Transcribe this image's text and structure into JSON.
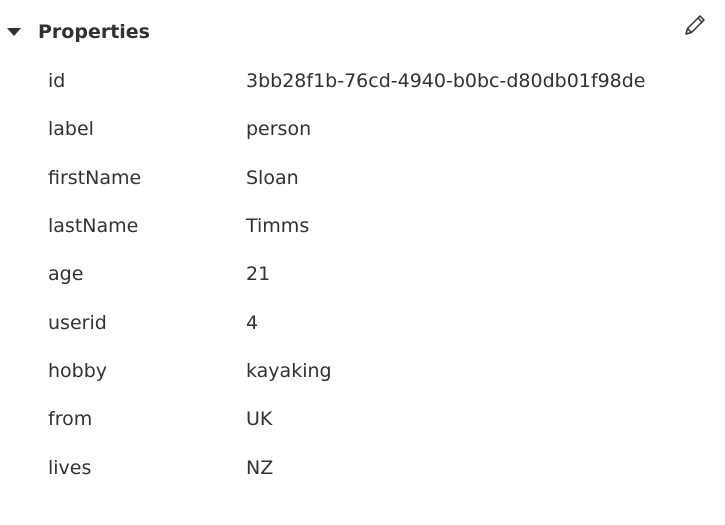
{
  "properties": {
    "title": "Properties",
    "caret_icon": "caret-down-icon",
    "edit_icon": "pencil-icon",
    "rows": [
      {
        "key": "id",
        "value": "3bb28f1b-76cd-4940-b0bc-d80db01f98de"
      },
      {
        "key": "label",
        "value": "person"
      },
      {
        "key": "firstName",
        "value": "Sloan"
      },
      {
        "key": "lastName",
        "value": "Timms"
      },
      {
        "key": "age",
        "value": "21"
      },
      {
        "key": "userid",
        "value": "4"
      },
      {
        "key": "hobby",
        "value": "kayaking"
      },
      {
        "key": "from",
        "value": "UK"
      },
      {
        "key": "lives",
        "value": "NZ"
      }
    ]
  }
}
